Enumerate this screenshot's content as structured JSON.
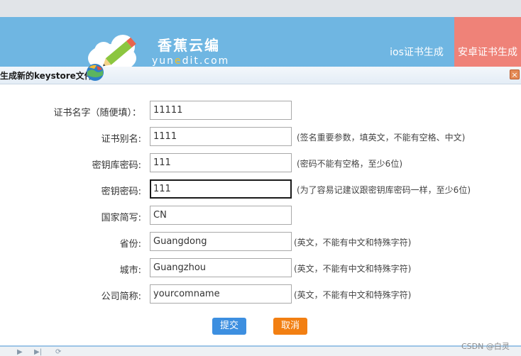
{
  "banner": {
    "logo_title": "香蕉云编",
    "logo_sub_a": "yun",
    "logo_sub_b": "e",
    "logo_sub_c": "dit.com",
    "tab_ios": "ios证书生成",
    "tab_android": "安卓证书生成"
  },
  "dialog": {
    "title": "生成新的keystore文件",
    "close_symbol": "×"
  },
  "form": {
    "fields": [
      {
        "label": "证书名字（随便填）：",
        "value": "11111",
        "hint": ""
      },
      {
        "label": "证书别名:",
        "value": "1111",
        "hint": "(签名重要参数，填英文，不能有空格、中文)"
      },
      {
        "label": "密钥库密码:",
        "value": "111",
        "hint": "(密码不能有空格，至少6位)"
      },
      {
        "label": "密钥密码:",
        "value": "111",
        "hint": "(为了容易记建议跟密钥库密码一样，至少6位)"
      },
      {
        "label": "国家简写:",
        "value": "CN",
        "hint": ""
      },
      {
        "label": "省份:",
        "value": "Guangdong",
        "hint": "(英文，不能有中文和特殊字符)"
      },
      {
        "label": "城市:",
        "value": "Guangzhou",
        "hint": "(英文，不能有中文和特殊字符)"
      },
      {
        "label": "公司简称:",
        "value": "yourcomname",
        "hint": "(英文，不能有中文和特殊字符)"
      }
    ],
    "submit_label": "提交",
    "cancel_label": "取消"
  },
  "watermark": "CSDN @白灵",
  "colors": {
    "banner": "#6fb6e2",
    "android_tab": "#ef8278",
    "submit": "#3d8fe0",
    "cancel": "#f27f12"
  }
}
